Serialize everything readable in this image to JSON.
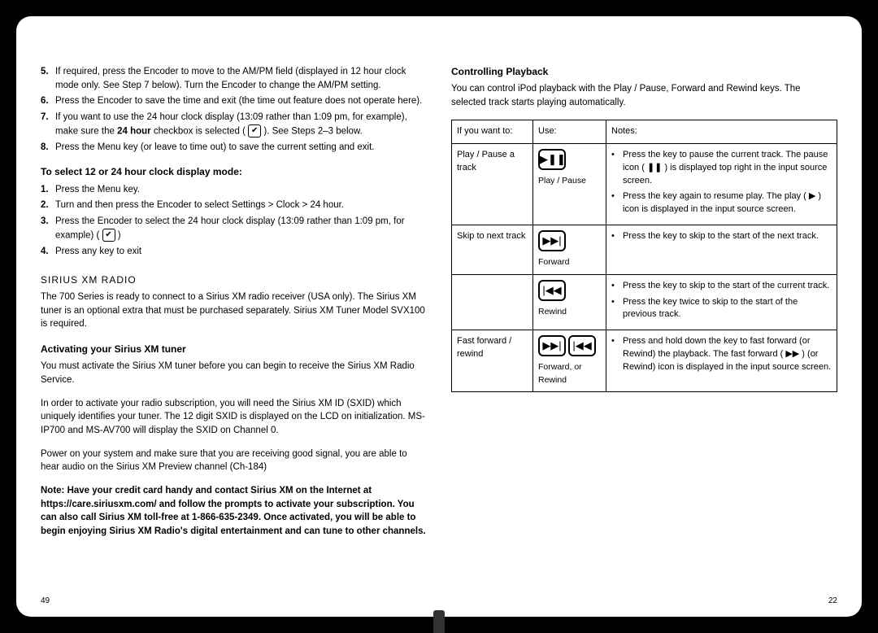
{
  "left": {
    "steps_top": [
      {
        "n": "5.",
        "t": "If required, press the Encoder to move to the AM/PM field (displayed in 12 hour clock mode only. See Step 7 below). Turn the Encoder to change the AM/PM setting."
      },
      {
        "n": "6.",
        "t": "Press the Encoder to save the time and exit (the time out feature does not operate here)."
      },
      {
        "n": "7.",
        "t_pre": "If you want to use the 24 hour clock display (13:09 rather than 1:09 pm, for example), make sure the ",
        "t_bold": "24 hour",
        "t_mid": " checkbox is selected ( ",
        "t_post": " ). See Steps 2–3 below."
      },
      {
        "n": "8.",
        "t": "Press the Menu key (or leave to time out) to save the current setting and exit."
      }
    ],
    "h_select": "To select 12 or 24 hour clock display mode:",
    "steps_select": [
      {
        "n": "1.",
        "t": "Press the Menu key."
      },
      {
        "n": "2.",
        "t": "Turn and then press the Encoder to select Settings > Clock > 24 hour."
      },
      {
        "n": "3.",
        "t_pre": "Press the Encoder to select the 24 hour clock display (13:09 rather than 1:09 pm, for example) ( ",
        "t_post": " )"
      },
      {
        "n": "4.",
        "t": "Press any key to exit"
      }
    ],
    "h_sirius": "SIRIUS XM RADIO",
    "sirius_body": "The 700 Series is ready to connect to a Sirius XM radio receiver (USA only). The Sirius XM tuner is an optional extra that must be purchased separately. Sirius XM Tuner Model SVX100 is required.",
    "h_activate": "Activating your Sirius XM tuner",
    "activate_1": "You must activate the Sirius XM tuner before you can begin to receive the Sirius XM Radio Service.",
    "activate_2": "In order to activate your radio subscription, you will need the Sirius XM ID (SXID) which uniquely identifies your tuner. The 12 digit SXID is displayed on the LCD on initialization. MS-IP700 and MS-AV700 will display the SXID on Channel 0.",
    "activate_3": "Power on your system and make sure that you are receiving good signal, you are able to hear audio on the Sirius XM Preview channel (Ch-184)",
    "note": "Note: Have your credit card handy and contact Sirius XM on the Internet at https://care.siriusxm.com/ and follow the prompts to activate your subscription. You can also call Sirius XM toll-free at 1-866-635-2349. Once activated, you will be able to begin enjoying Sirius XM Radio's digital entertainment and can tune to other channels.",
    "page": "49"
  },
  "right": {
    "h_playback": "Controlling Playback",
    "playback_intro": "You can control iPod playback with the Play / Pause, Forward and Rewind keys. The selected track starts playing automatically.",
    "th": {
      "a": "If you want to:",
      "b": "Use:",
      "c": "Notes:"
    },
    "rows": [
      {
        "want": "Play / Pause a track",
        "icon": "▶❚❚",
        "label": "Play / Pause",
        "notes": [
          "Press the key to pause the current track. The pause icon ( ❚❚ ) is displayed top right in the input source screen.",
          "Press the key again to resume play. The play ( ▶ ) icon is displayed in the input source screen."
        ]
      },
      {
        "want": "Skip to next track",
        "icon": "▶▶|",
        "label": "Forward",
        "notes": [
          "Press the key to skip to the start of the next track."
        ]
      },
      {
        "want": "",
        "icon": "|◀◀",
        "label": "Rewind",
        "notes": [
          "Press the key to skip to the start of the current track.",
          "Press the key twice to skip to the start of the previous track."
        ]
      },
      {
        "want": "Fast forward / rewind",
        "icon": "▶▶|",
        "icon2": "|◀◀",
        "label": "Forward, or Rewind",
        "notes": [
          "Press and hold down the key to fast forward (or Rewind) the playback. The fast forward ( ▶▶ ) (or Rewind) icon is displayed in the input source screen."
        ]
      }
    ],
    "page": "22"
  }
}
